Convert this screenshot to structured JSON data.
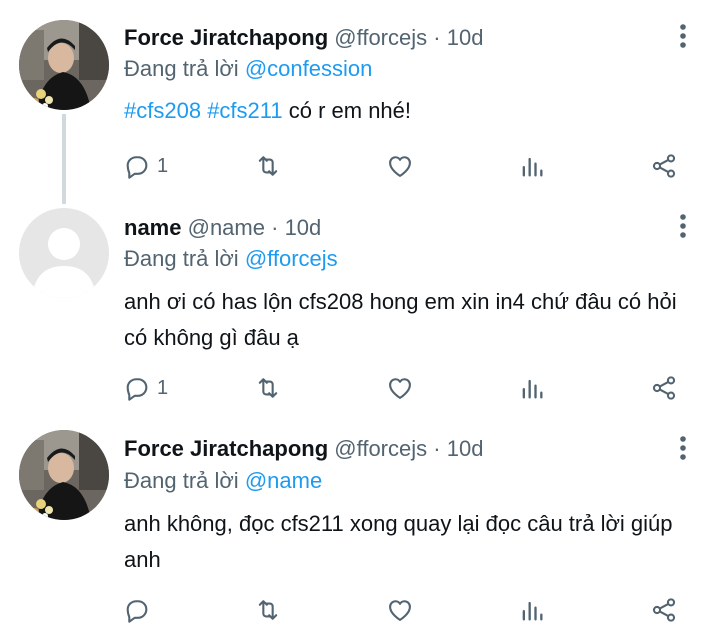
{
  "tweets": [
    {
      "display_name": "Force Jiratchapong",
      "handle": "@fforcejs",
      "dot": "·",
      "time": "10d",
      "replying_prefix": "Đang trả lời",
      "replying_to": "@confession",
      "text_before": "",
      "hashtags": [
        "#cfs208",
        "#cfs211"
      ],
      "text_after": "có r em nhé!",
      "reply_count": "1",
      "avatar": "photo"
    },
    {
      "display_name": "name",
      "handle": "@name",
      "dot": "·",
      "time": "10d",
      "replying_prefix": "Đang trả lời",
      "replying_to": "@fforcejs",
      "text": "anh ơi có has lộn cfs208 hong em xin in4 chứ đâu có hỏi có không gì đâu ạ",
      "reply_count": "1",
      "avatar": "default"
    },
    {
      "display_name": "Force Jiratchapong",
      "handle": "@fforcejs",
      "dot": "·",
      "time": "10d",
      "replying_prefix": "Đang trả lời",
      "replying_to": "@name",
      "text": "anh không, đọc cfs211 xong quay lại đọc câu trả lời giúp anh",
      "reply_count": "",
      "avatar": "photo"
    }
  ],
  "icons": {
    "reply": "reply-icon",
    "retweet": "retweet-icon",
    "like": "like-icon",
    "views": "views-icon",
    "share": "share-icon",
    "more": "more-icon"
  },
  "colors": {
    "accent": "#1d9bf0",
    "secondary_text": "#536471",
    "thread_line": "#cfd9de"
  }
}
